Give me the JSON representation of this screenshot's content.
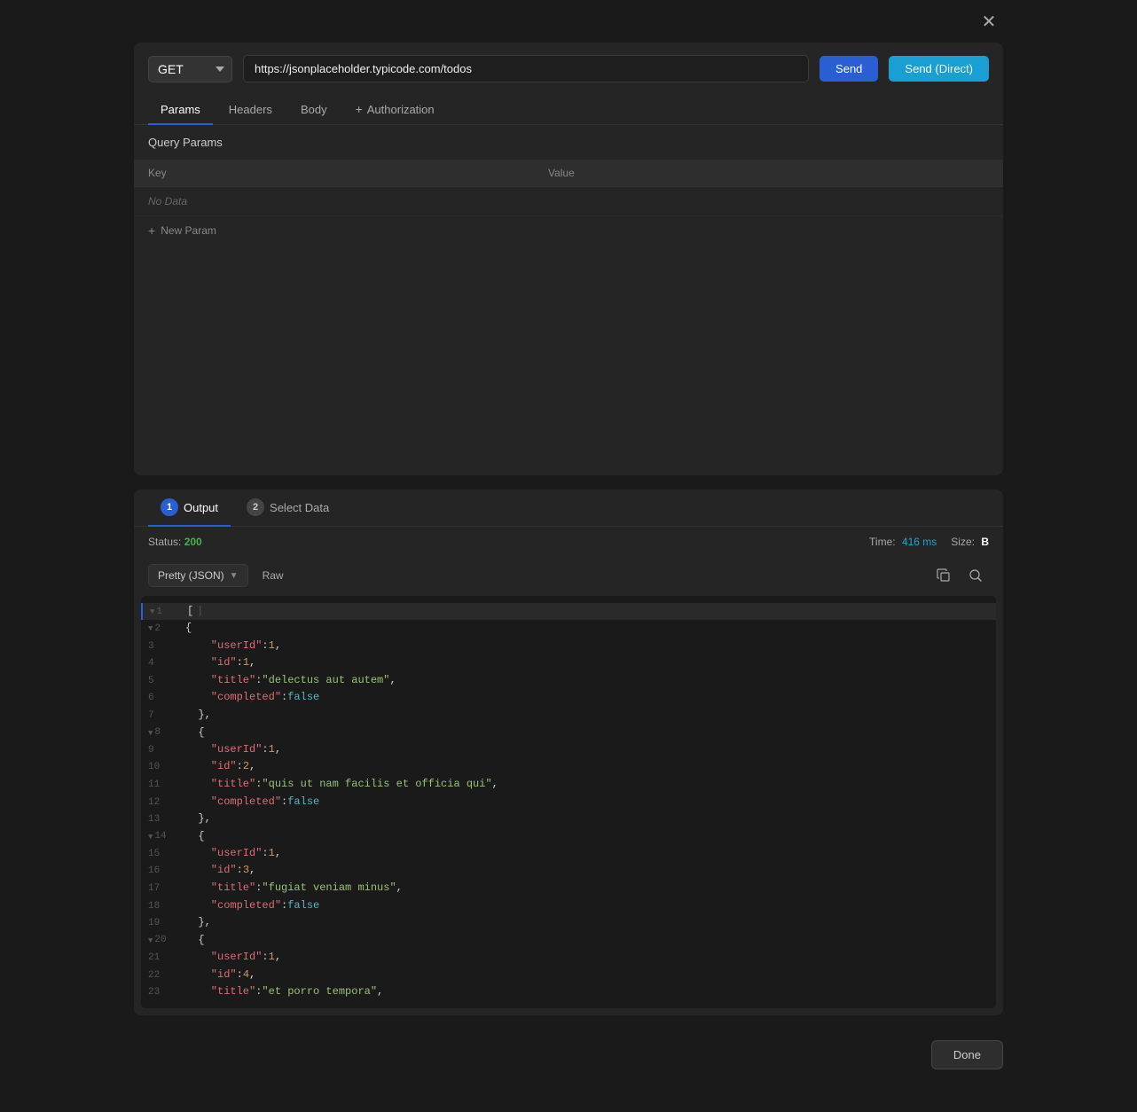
{
  "modal": {
    "close_label": "✕"
  },
  "request": {
    "method": "GET",
    "url": "https://jsonplaceholder.typicode.com/todos",
    "send_label": "Send",
    "send_direct_label": "Send (Direct)"
  },
  "tabs": {
    "params_label": "Params",
    "headers_label": "Headers",
    "body_label": "Body",
    "auth_label": "Authorization"
  },
  "query_params": {
    "title": "Query Params",
    "key_header": "Key",
    "value_header": "Value",
    "no_data": "No Data",
    "new_param_label": "New Param"
  },
  "output": {
    "tab1_num": "1",
    "tab1_label": "Output",
    "tab2_num": "2",
    "tab2_label": "Select Data",
    "status_label": "Status:",
    "status_value": "200",
    "time_label": "Time:",
    "time_value": "416 ms",
    "size_label": "Size:",
    "size_value": "B",
    "format_label": "Pretty (JSON)",
    "raw_label": "Raw"
  },
  "code_lines": [
    {
      "num": "1",
      "fold": true,
      "content": "",
      "type": "array_open"
    },
    {
      "num": "2",
      "fold": true,
      "content": "  {",
      "type": "obj_open"
    },
    {
      "num": "3",
      "content": "    \"userId\": 1,",
      "key": "userId",
      "val": "1",
      "val_type": "num"
    },
    {
      "num": "4",
      "content": "    \"id\": 1,",
      "key": "id",
      "val": "1",
      "val_type": "num"
    },
    {
      "num": "5",
      "content": "    \"title\": \"delectus aut autem\",",
      "key": "title",
      "val": "delectus aut autem",
      "val_type": "string"
    },
    {
      "num": "6",
      "content": "    \"completed\": false",
      "key": "completed",
      "val": "false",
      "val_type": "bool"
    },
    {
      "num": "7",
      "content": "  },",
      "type": "obj_close"
    },
    {
      "num": "8",
      "fold": true,
      "content": "  {",
      "type": "obj_open"
    },
    {
      "num": "9",
      "content": "    \"userId\": 1,",
      "key": "userId",
      "val": "1",
      "val_type": "num"
    },
    {
      "num": "10",
      "content": "    \"id\": 2,",
      "key": "id",
      "val": "2",
      "val_type": "num"
    },
    {
      "num": "11",
      "content": "    \"title\": \"quis ut nam facilis et officia qui\",",
      "key": "title",
      "val": "quis ut nam facilis et officia qui",
      "val_type": "string"
    },
    {
      "num": "12",
      "content": "    \"completed\": false",
      "key": "completed",
      "val": "false",
      "val_type": "bool"
    },
    {
      "num": "13",
      "content": "  },",
      "type": "obj_close"
    },
    {
      "num": "14",
      "fold": true,
      "content": "  {",
      "type": "obj_open"
    },
    {
      "num": "15",
      "content": "    \"userId\": 1,",
      "key": "userId",
      "val": "1",
      "val_type": "num"
    },
    {
      "num": "16",
      "content": "    \"id\": 3,",
      "key": "id",
      "val": "3",
      "val_type": "num"
    },
    {
      "num": "17",
      "content": "    \"title\": \"fugiat veniam minus\",",
      "key": "title",
      "val": "fugiat veniam minus",
      "val_type": "string"
    },
    {
      "num": "18",
      "content": "    \"completed\": false",
      "key": "completed",
      "val": "false",
      "val_type": "bool"
    },
    {
      "num": "19",
      "content": "  },",
      "type": "obj_close"
    },
    {
      "num": "20",
      "fold": true,
      "content": "  {",
      "type": "obj_open"
    },
    {
      "num": "21",
      "content": "    \"userId\": 1,",
      "key": "userId",
      "val": "1",
      "val_type": "num"
    },
    {
      "num": "22",
      "content": "    \"id\": 4,",
      "key": "id",
      "val": "4",
      "val_type": "num"
    },
    {
      "num": "23",
      "content": "    \"title\": \"et porro tempora\",",
      "key": "title",
      "val": "et porro tempora",
      "val_type": "string"
    }
  ],
  "done_label": "Done"
}
